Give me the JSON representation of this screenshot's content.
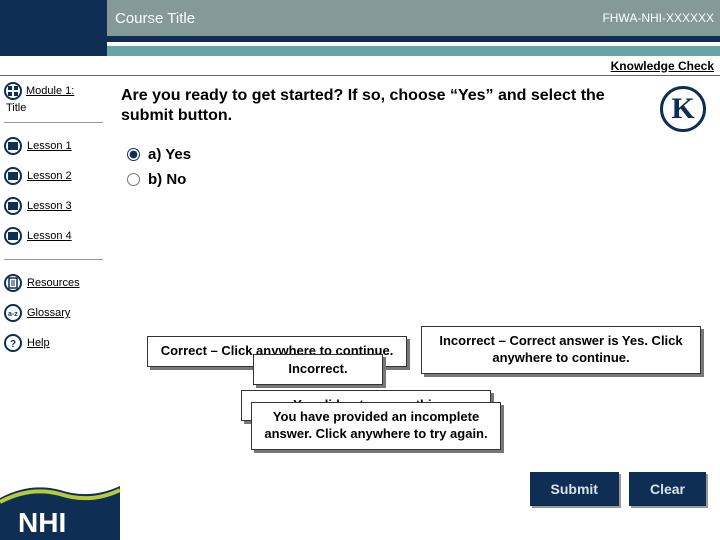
{
  "header": {
    "course_title": "Course Title",
    "course_code": "FHWA-NHI-XXXXXX",
    "knowledge_check": "Knowledge Check"
  },
  "sidebar": {
    "module_label": "Module 1:",
    "title_label": "Title",
    "lessons": [
      {
        "label": "Lesson 1"
      },
      {
        "label": "Lesson 2"
      },
      {
        "label": "Lesson 3"
      },
      {
        "label": "Lesson 4"
      }
    ],
    "resources": "Resources",
    "glossary": "Glossary",
    "help": "Help"
  },
  "main": {
    "question": "Are you ready to get started? If so, choose “Yes” and select the submit button.",
    "answers": {
      "a": "a) Yes",
      "b": "b) No"
    },
    "feedback": {
      "correct": "Correct – Click anywhere to continue.",
      "incorrect_label": "Incorrect.",
      "incorrect_answer": "Incorrect – Correct answer is Yes. Click anywhere to continue.",
      "not_answered": "You did not answer this",
      "incomplete": "You have provided an incomplete answer. Click anywhere to try again."
    },
    "buttons": {
      "submit": "Submit",
      "clear": "Clear"
    }
  },
  "footer": {
    "brand": "NHI"
  },
  "icons": {
    "module": "grid-icon",
    "lesson": "book-icon",
    "resources": "doc-icon",
    "glossary": "az-icon",
    "help": "question-icon",
    "knowledge": "k-icon"
  },
  "colors": {
    "navy": "#0e2e54",
    "header_gray": "#869999",
    "teal": "#69a4a4"
  }
}
